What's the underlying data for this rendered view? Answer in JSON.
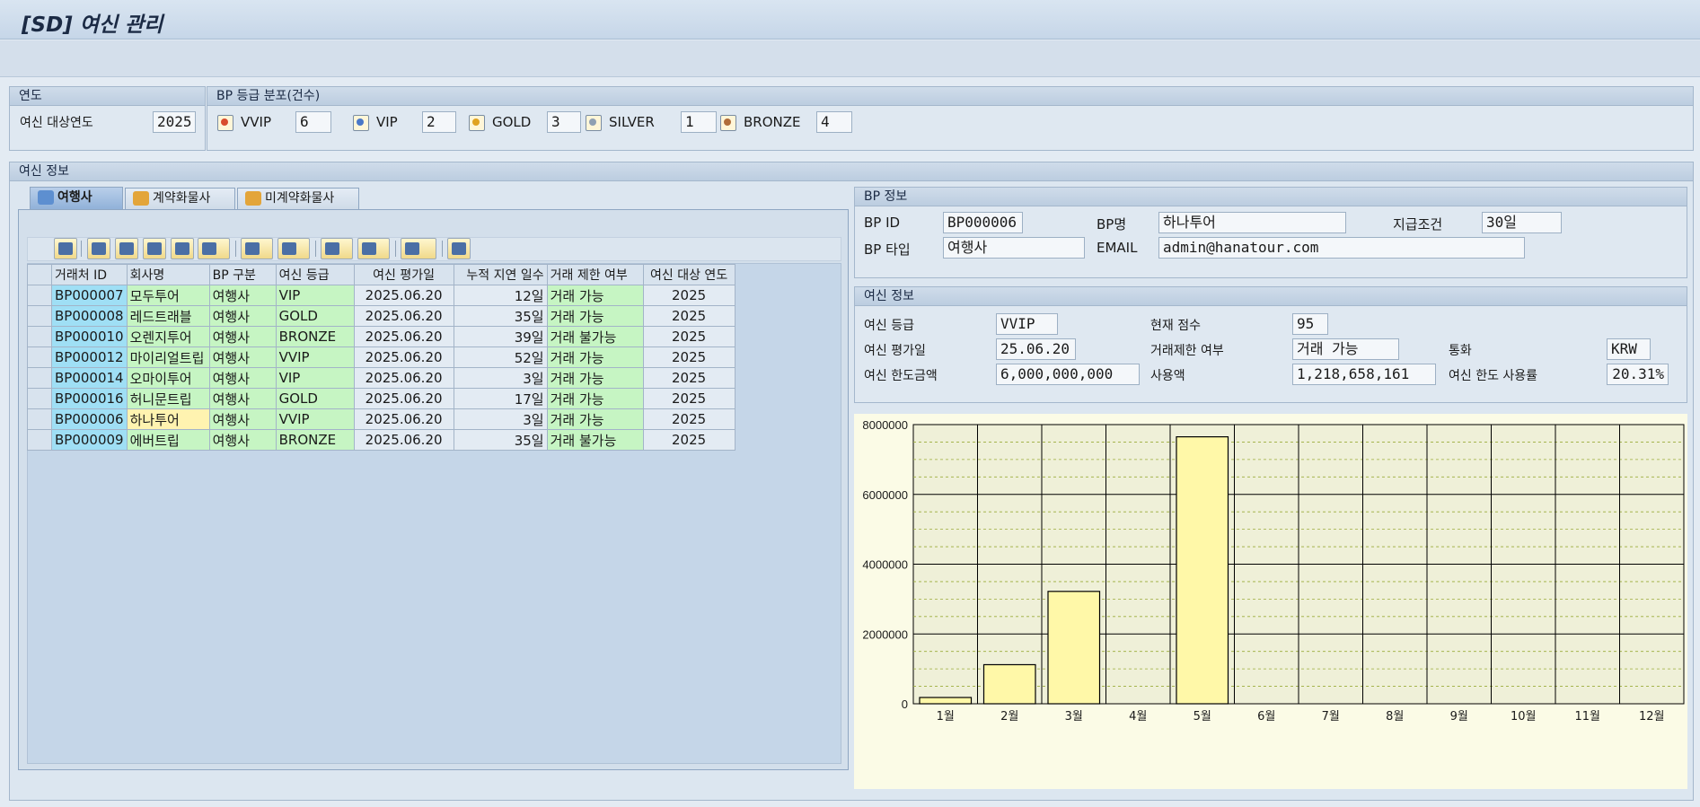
{
  "window": {
    "title": "[SD] 여신 관리"
  },
  "year_group": {
    "header": "연도",
    "label": "여신 대상연도",
    "value": "2025"
  },
  "grade_group": {
    "header": "BP 등급 분포(건수)",
    "items": [
      {
        "label": "VVIP",
        "count": "6",
        "icon": "vvip-grade-icon"
      },
      {
        "label": "VIP",
        "count": "2",
        "icon": "vip-grade-icon"
      },
      {
        "label": "GOLD",
        "count": "3",
        "icon": "gold-grade-icon"
      },
      {
        "label": "SILVER",
        "count": "1",
        "icon": "silver-grade-icon"
      },
      {
        "label": "BRONZE",
        "count": "4",
        "icon": "bronze-grade-icon"
      }
    ]
  },
  "credit_section": {
    "header": "여신 정보"
  },
  "tabs": [
    {
      "label": "여행사",
      "icon": "travel-agency-icon",
      "active": true
    },
    {
      "label": "계약화물사",
      "icon": "contract-cargo-icon",
      "active": false
    },
    {
      "label": "미계약화물사",
      "icon": "noncontract-cargo-icon",
      "active": false
    }
  ],
  "table": {
    "columns": [
      "거래처 ID",
      "회사명",
      "BP 구분",
      "여신 등급",
      "여신 평가일",
      "누적 지연 일수",
      "거래 제한 여부",
      "여신 대상 연도"
    ],
    "rows": [
      [
        "BP000007",
        "모두투어",
        "여행사",
        "VIP",
        "2025.06.20",
        "12일",
        "거래 가능",
        "2025"
      ],
      [
        "BP000008",
        "레드트래블",
        "여행사",
        "GOLD",
        "2025.06.20",
        "35일",
        "거래 가능",
        "2025"
      ],
      [
        "BP000010",
        "오렌지투어",
        "여행사",
        "BRONZE",
        "2025.06.20",
        "39일",
        "거래 불가능",
        "2025"
      ],
      [
        "BP000012",
        "마이리얼트립",
        "여행사",
        "VVIP",
        "2025.06.20",
        "52일",
        "거래 가능",
        "2025"
      ],
      [
        "BP000014",
        "오마이투어",
        "여행사",
        "VIP",
        "2025.06.20",
        "3일",
        "거래 가능",
        "2025"
      ],
      [
        "BP000016",
        "허니문트립",
        "여행사",
        "GOLD",
        "2025.06.20",
        "17일",
        "거래 가능",
        "2025"
      ],
      [
        "BP000006",
        "하나투어",
        "여행사",
        "VVIP",
        "2025.06.20",
        "3일",
        "거래 가능",
        "2025"
      ],
      [
        "BP000009",
        "에버트립",
        "여행사",
        "BRONZE",
        "2025.06.20",
        "35일",
        "거래 불가능",
        "2025"
      ]
    ],
    "selected_row": 6
  },
  "bp_info": {
    "header": "BP 정보",
    "id_label": "BP ID",
    "id_value": "BP000006",
    "name_label": "BP명",
    "name_value": "하나투어",
    "payment_label": "지급조건",
    "payment_value": "30일",
    "type_label": "BP 타입",
    "type_value": "여행사",
    "email_label": "EMAIL",
    "email_value": "admin@hanatour.com"
  },
  "credit_info": {
    "header": "여신 정보",
    "grade_label": "여신 등급",
    "grade_value": "VVIP",
    "score_label": "현재 점수",
    "score_value": "95",
    "eval_label": "여신 평가일",
    "eval_value": "25.06.20",
    "restrict_label": "거래제한 여부",
    "restrict_value": "거래 가능",
    "currency_label": "통화",
    "currency_value": "KRW",
    "limit_label": "여신 한도금액",
    "limit_value": "6,000,000,000",
    "used_label": "사용액",
    "used_value": "1,218,658,161",
    "usage_label": "여신 한도 사용률",
    "usage_value": "20.31%"
  },
  "colors": {
    "bar_fill": "#fff8a8",
    "chart_bg": "#eff0d8",
    "grade_bg": "#c6f5c3",
    "id_bg": "#9fdff5"
  },
  "chart_data": {
    "type": "bar",
    "categories": [
      "1월",
      "2월",
      "3월",
      "4월",
      "5월",
      "6월",
      "7월",
      "8월",
      "9월",
      "10월",
      "11월",
      "12월"
    ],
    "values": [
      180000,
      1120000,
      3220000,
      0,
      7650000,
      0,
      0,
      0,
      0,
      0,
      0,
      0
    ],
    "ylim": [
      0,
      8000000
    ],
    "yticks": [
      "0",
      "2000000",
      "4000000",
      "6000000",
      "8000000"
    ],
    "grid": true
  }
}
